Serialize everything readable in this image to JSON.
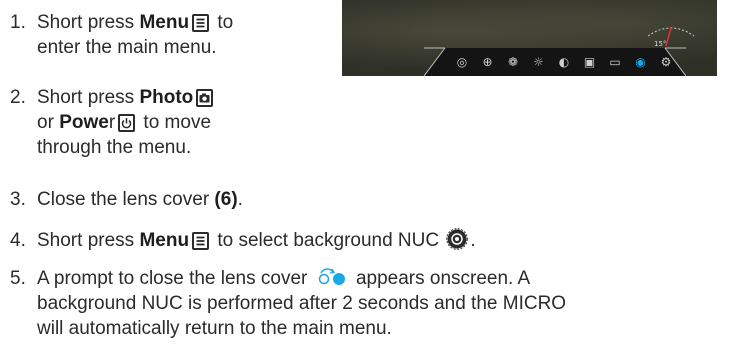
{
  "steps": [
    {
      "number": "1.",
      "lines": [
        [
          "Short press ",
          "Menu",
          " to"
        ],
        [
          "enter the main menu."
        ]
      ]
    },
    {
      "number": "2.",
      "lines": [
        [
          "Short press ",
          "Photo"
        ],
        [
          "or ",
          "Powe",
          "r",
          " to move"
        ],
        [
          "through the menu."
        ]
      ]
    },
    {
      "number": "3.",
      "text_before": "Close the lens cover ",
      "text_bold": "(6)",
      "text_after": "."
    },
    {
      "number": "4.",
      "text_before": "Short press ",
      "text_bold": "Menu",
      "text_mid": " to select background NUC ",
      "text_after": "."
    },
    {
      "number": "5.",
      "lines": [
        "A prompt to close the lens cover",
        "appears onscreen. A",
        "background NUC is performed after 2 seconds and the MICRO",
        "will automatically return to the main menu."
      ]
    }
  ],
  "screen": {
    "compass_reading": "15°",
    "menu_icons": [
      "reticle-icon",
      "zoom-icon",
      "palette-icon",
      "brightness-icon",
      "contrast-icon",
      "image-mode-icon",
      "folder-icon",
      "nuc-icon",
      "settings-icon"
    ],
    "menu_glyphs": [
      "◎",
      "⊕",
      "❁",
      "☼",
      "◐",
      "▣",
      "▭",
      "◉",
      "⚙"
    ],
    "active_icon": "nuc-icon",
    "accent_color": "#1aa7e6"
  },
  "colors": {
    "text": "#2b2b2b",
    "accent": "#1aa7e6"
  }
}
